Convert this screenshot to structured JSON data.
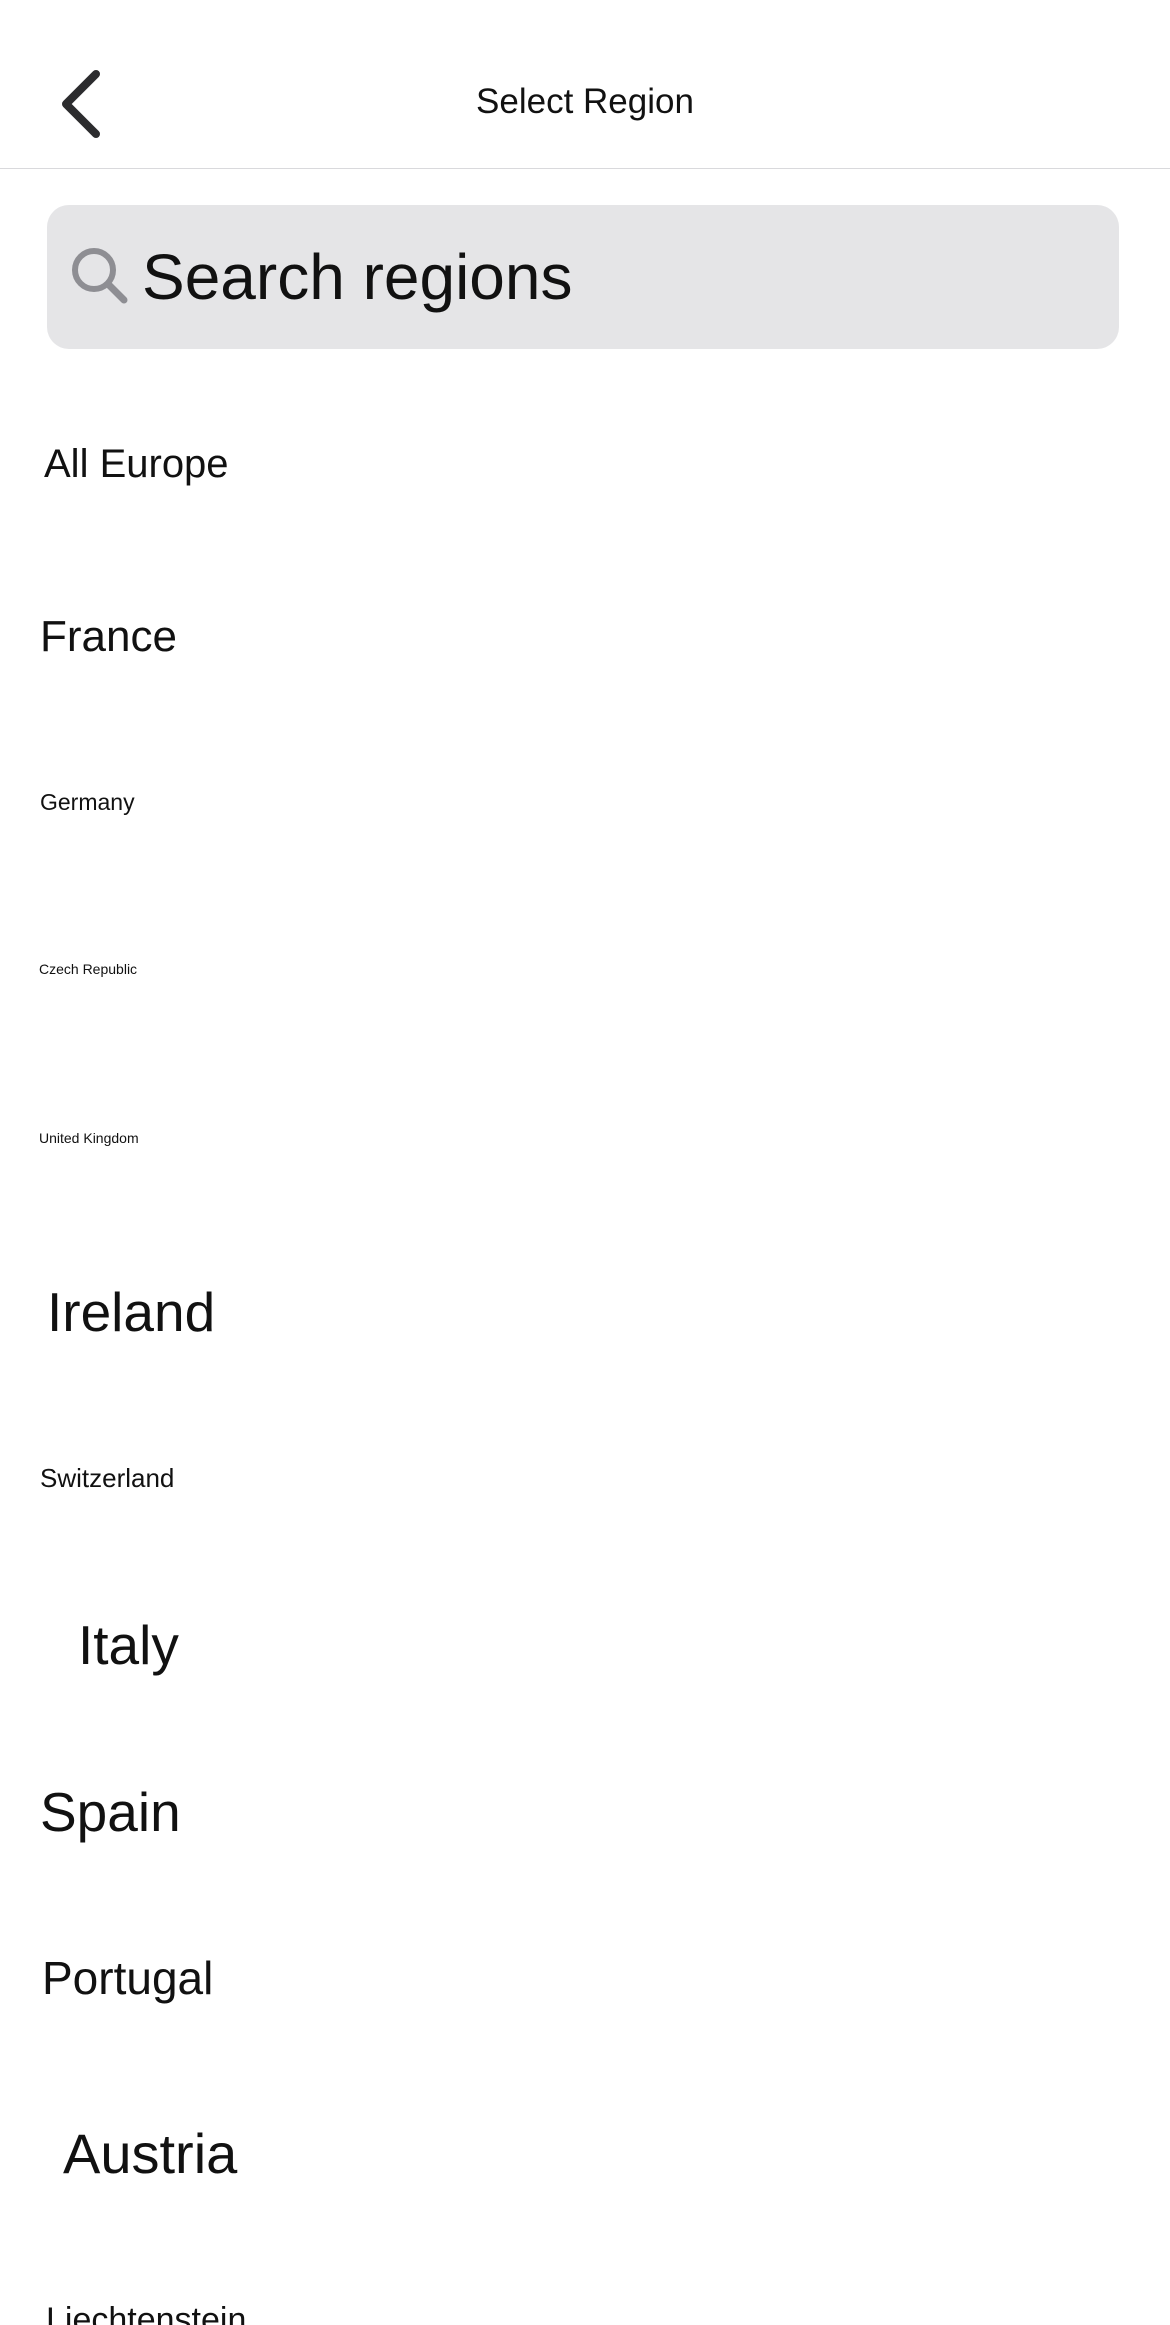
{
  "header": {
    "title": "Select Region",
    "back_icon": "chevron-left-icon"
  },
  "search": {
    "placeholder": "Search regions",
    "value": "",
    "icon": "search-icon"
  },
  "regions": [
    {
      "label": "All Europe"
    },
    {
      "label": "France"
    },
    {
      "label": "Germany"
    },
    {
      "label": "Czech Republic"
    },
    {
      "label": "United Kingdom"
    },
    {
      "label": "Ireland"
    },
    {
      "label": "Switzerland"
    },
    {
      "label": "Italy"
    },
    {
      "label": "Spain"
    },
    {
      "label": "Portugal"
    },
    {
      "label": "Austria"
    },
    {
      "label": "Liechtenstein"
    }
  ],
  "colors": {
    "background": "#ffffff",
    "search_background": "#e5e5e7",
    "icon_gray": "#8e8e93",
    "text": "#111111"
  }
}
